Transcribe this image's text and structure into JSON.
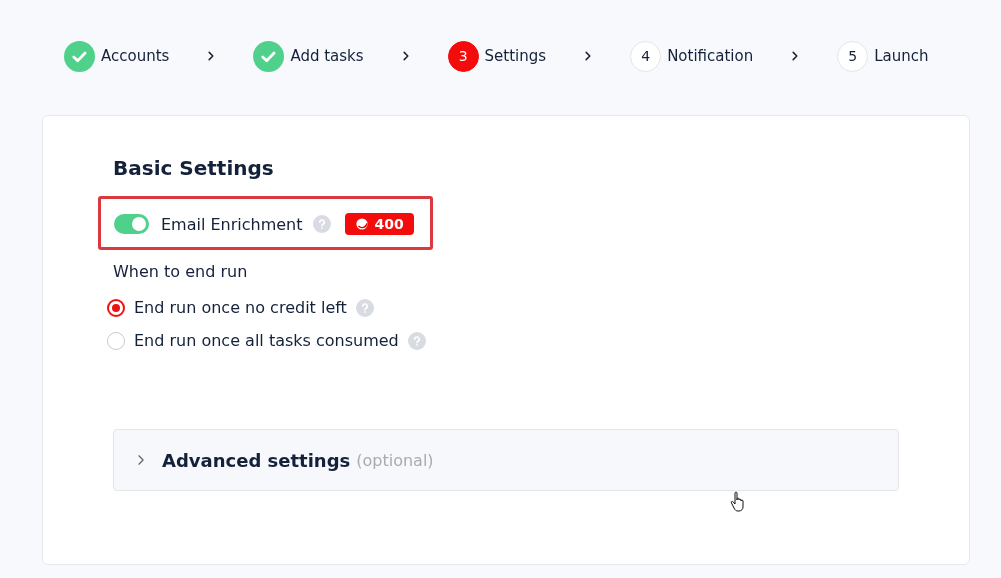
{
  "steps": [
    {
      "label": "Accounts",
      "completed": true,
      "selected": false
    },
    {
      "label": "Add tasks",
      "completed": true,
      "selected": false
    },
    {
      "number": "3",
      "label": "Settings",
      "completed": false,
      "selected": true
    },
    {
      "number": "4",
      "label": "Notification",
      "completed": false,
      "selected": false
    },
    {
      "number": "5",
      "label": "Launch",
      "completed": false,
      "selected": false
    }
  ],
  "section_title": "Basic Settings",
  "email_enrichment": {
    "label": "Email Enrichment",
    "on": true,
    "credits": "400",
    "highlighted": true
  },
  "end_run": {
    "title": "When to end run",
    "options": [
      {
        "label": "End run once no credit left",
        "selected": true
      },
      {
        "label": "End run once all tasks consumed",
        "selected": false
      }
    ]
  },
  "advanced": {
    "title": "Advanced settings",
    "note": "(optional)",
    "expanded": false
  }
}
